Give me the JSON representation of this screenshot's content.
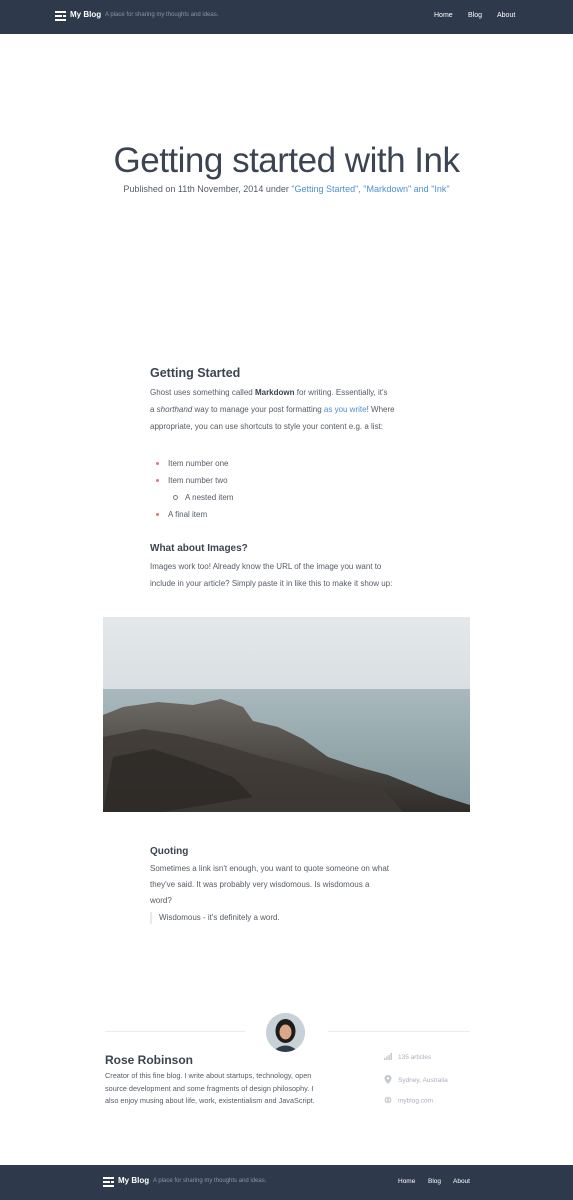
{
  "header": {
    "brand": "My Blog",
    "tagline": "A place for sharing my thoughts and ideas.",
    "nav": [
      "Home",
      "Blog",
      "About"
    ]
  },
  "post": {
    "title": "Getting started with Ink",
    "meta_prefix": "Published on 11th November, 2014 under ",
    "meta_tags": "\"Getting Started\", \"Markdown\" and \"Ink\""
  },
  "content": {
    "section1_heading": "Getting Started",
    "section1_para": {
      "t1": "Ghost uses something called ",
      "bold": "Markdown",
      "t2": " for writing. Essentially, it's",
      "t3": "a ",
      "italic": "shorthand",
      "t4": " way to manage your post formatting ",
      "link": "as you write",
      "t5": "! Where",
      "line3": "appropriate, you can use shortcuts to style your content e.g. a list:"
    },
    "list": {
      "item1": "Item number one",
      "item2": "Item number two",
      "nested": "A nested item",
      "item3": "A final item"
    },
    "section2_heading": "What about Images?",
    "section2_line1": "Images work too! Already know the URL of the image you want to",
    "section2_line2": "include in your article? Simply paste it in like this to make it show up:",
    "section3_heading": "Quoting",
    "section3_line1": "Sometimes a link isn't enough, you want to quote someone on what",
    "section3_line2": "they've said. It was probably very wisdomous. Is wisdomous a",
    "section3_line3": "word?",
    "quote": "Wisdomous - it's definitely a word."
  },
  "author": {
    "name": "Rose Robinson",
    "bio_line1": "Creator of this fine blog. I write about startups, technology, open",
    "bio_line2": "source development and some fragments of design philosophy. I",
    "bio_line3": "also enjoy musing about life, work, existentialism and JavaScript.",
    "articles": "135 articles",
    "location": "Sydney, Australia",
    "website": "myblog.com"
  },
  "footer": {
    "brand": "My Blog",
    "tagline": "A place for sharing my thoughts and ideas.",
    "nav": [
      "Home",
      "Blog",
      "About"
    ]
  },
  "colors": {
    "navbar": "#2e3a4c",
    "link": "#4a90d9",
    "bullet": "#e47474"
  }
}
